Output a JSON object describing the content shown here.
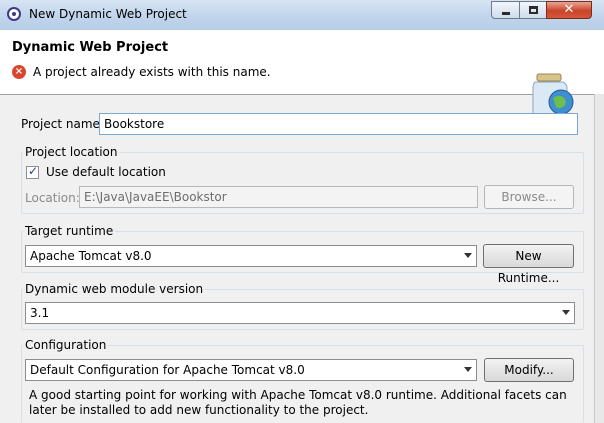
{
  "window": {
    "title": "New Dynamic Web Project",
    "close_label": "✕"
  },
  "banner": {
    "title": "Dynamic Web Project",
    "message": "A project already exists with this name."
  },
  "project_name": {
    "label": "Project name:",
    "value": "Bookstore"
  },
  "project_location": {
    "group_label": "Project location",
    "use_default_label": "Use default location",
    "use_default_checked": true,
    "location_label": "Location:",
    "location_value": "E:\\Java\\JavaEE\\Bookstor",
    "browse_label": "Browse..."
  },
  "target_runtime": {
    "group_label": "Target runtime",
    "selected": "Apache Tomcat v8.0",
    "new_runtime_label": "New Runtime..."
  },
  "module_version": {
    "group_label": "Dynamic web module version",
    "selected": "3.1"
  },
  "configuration": {
    "group_label": "Configuration",
    "selected": "Default Configuration for Apache Tomcat v8.0",
    "modify_label": "Modify...",
    "description": "A good starting point for working with Apache Tomcat v8.0 runtime. Additional facets can later be installed to add new functionality to the project."
  },
  "icons": {
    "app": "eclipse-icon",
    "error": "error-icon",
    "banner": "web-project-jar-globe-icon"
  },
  "colors": {
    "error_red": "#d9452f",
    "focus_border": "#7aa6cf",
    "close_red": "#c9452a"
  }
}
